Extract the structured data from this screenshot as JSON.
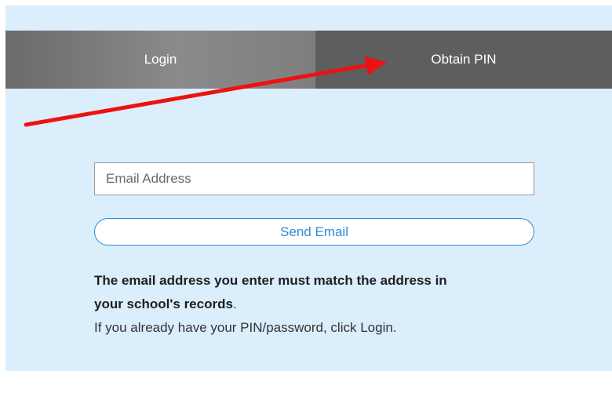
{
  "tabs": {
    "login_label": "Login",
    "obtain_pin_label": "Obtain PIN"
  },
  "form": {
    "email_placeholder": "Email Address",
    "email_value": "",
    "send_label": "Send Email"
  },
  "info": {
    "line1_strong": "The email address you enter must match the address in",
    "line2_strong": "your school's records",
    "line2_suffix": ".",
    "line3": "If you already have your PIN/password, click Login."
  },
  "colors": {
    "panel_bg": "#dbeefb",
    "tab_active": "#5e5e5e",
    "button_accent": "#2e8bd8",
    "annotation_arrow": "#ee1111"
  },
  "annotation": {
    "arrow_icon": "red-arrow-icon"
  }
}
